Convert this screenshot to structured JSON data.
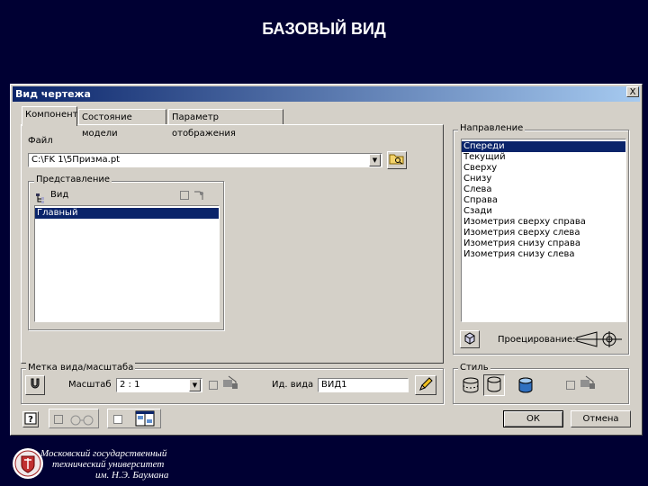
{
  "slide": {
    "title": "БАЗОВЫЙ ВИД"
  },
  "dialog": {
    "title": "Вид чертежа",
    "close": "X",
    "tabs": [
      "Компонент",
      "Состояние модели",
      "Параметр отображения"
    ],
    "file": {
      "label": "Файл",
      "value": "C:\\FK 1\\5Призма.pt"
    },
    "representation": {
      "label": "Представление",
      "view_label": "Вид",
      "items": [
        "Главный"
      ]
    },
    "direction": {
      "label": "Направление",
      "items": [
        "Спереди",
        "Текущий",
        "Сверху",
        "Снизу",
        "Слева",
        "Справа",
        "Сзади",
        "Изометрия сверху справа",
        "Изометрия сверху слева",
        "Изометрия снизу справа",
        "Изометрия снизу слева"
      ],
      "projection_label": "Проецирование:"
    },
    "scale_group": {
      "label": "Метка вида/масштаба",
      "scale_label": "Масштаб",
      "scale_value": "2 : 1",
      "view_id_label": "Ид. вида",
      "view_id_value": "ВИД1"
    },
    "style_group": {
      "label": "Стиль"
    },
    "buttons": {
      "ok": "ОК",
      "cancel": "Отмена"
    }
  },
  "footer": {
    "line1": "Московский государственный",
    "line2": "технический университет",
    "line3": "им. Н.Э. Баумана"
  }
}
